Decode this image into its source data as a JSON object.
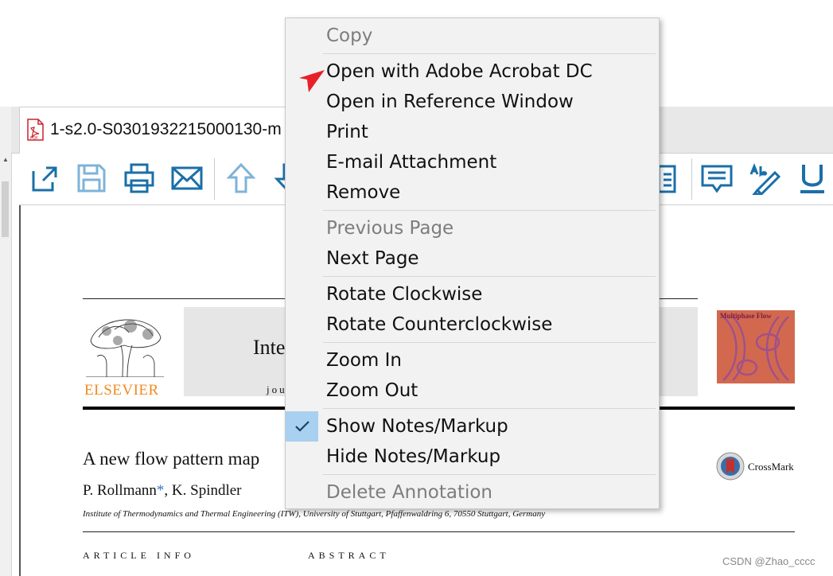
{
  "tab": {
    "title": "1-s2.0-S0301932215000130-m"
  },
  "context_menu": {
    "groups": [
      [
        {
          "label": "Copy",
          "enabled": false
        }
      ],
      [
        {
          "label": "Open with Adobe Acrobat DC",
          "enabled": true
        },
        {
          "label": "Open in Reference Window",
          "enabled": true
        },
        {
          "label": "Print",
          "enabled": true
        },
        {
          "label": "E-mail Attachment",
          "enabled": true
        },
        {
          "label": "Remove",
          "enabled": true
        }
      ],
      [
        {
          "label": "Previous Page",
          "enabled": false
        },
        {
          "label": "Next Page",
          "enabled": true
        }
      ],
      [
        {
          "label": "Rotate Clockwise",
          "enabled": true
        },
        {
          "label": "Rotate Counterclockwise",
          "enabled": true
        }
      ],
      [
        {
          "label": "Zoom In",
          "enabled": true
        },
        {
          "label": "Zoom Out",
          "enabled": true
        }
      ],
      [
        {
          "label": "Show Notes/Markup",
          "enabled": true,
          "checked": true
        },
        {
          "label": "Hide Notes/Markup",
          "enabled": true
        }
      ],
      [
        {
          "label": "Delete Annotation",
          "enabled": false
        }
      ]
    ]
  },
  "document": {
    "publisher": "ELSEVIER",
    "journal_title_fragment": "Inte",
    "journal_sub_fragment": "jou",
    "cover_title": "Multiphase Flow",
    "article_title_fragment": "A new flow pattern map",
    "authors_before_mark": "P. Rollmann",
    "author_mark": "*",
    "authors_after_mark": ", K. Spindler",
    "affiliation": "Institute of Thermodynamics and Thermal Engineering (ITW), University of Stuttgart, Pfaffenwaldring 6, 70550 Stuttgart, Germany",
    "crossmark_label": "CrossMark",
    "section_article_info": "ARTICLE INFO",
    "section_abstract": "ABSTRACT"
  },
  "watermark": "CSDN @Zhao_cccc",
  "colors": {
    "toolbar_icon": "#1a6fa8",
    "pointer_arrow": "#e8202a",
    "elsevier_orange": "#f08b20",
    "menu_check_highlight": "#a8d0f0"
  },
  "icons": {
    "toolbar": [
      "export-icon",
      "save-icon",
      "print-icon",
      "email-icon",
      "page-up-icon",
      "page-down-icon",
      "note-icon",
      "comment-icon",
      "highlight-text-icon",
      "underline-icon"
    ]
  }
}
